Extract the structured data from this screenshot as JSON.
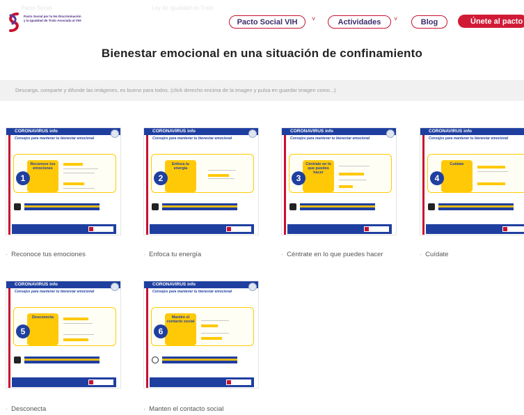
{
  "header": {
    "faded_left": "Pacto Social",
    "faded_mid": "Ley de Igualdad de Trato",
    "logo_text": "Pacto Social por la No Discriminación y la Igualdad de Trato Asociada al VIH",
    "nav": [
      {
        "label": "Pacto Social VIH",
        "has_dropdown": true
      },
      {
        "label": "Actividades",
        "has_dropdown": true
      },
      {
        "label": "Blog",
        "has_dropdown": false
      }
    ],
    "cta_label": "Únete al pacto",
    "accent": "#c8102e",
    "brand": "#3a2d6b"
  },
  "page": {
    "title": "Bienestar emocional en una situación de confinamiento",
    "banner_text": "Descarga, comparte y difunde las imágenes, es bueno para todos. (click derecho encima de la imagen y pulsa en guardar imagen como...)"
  },
  "cards": [
    {
      "number": "1",
      "box_text": "Reconoce tus emociones",
      "caption": "Reconoce tus emociones",
      "header": "CORONAVIRUS info",
      "sub": "Consejos para mantener tu bienestar emocional"
    },
    {
      "number": "2",
      "box_text": "Enfoca tu energía",
      "caption": "Enfoca tu energía",
      "header": "CORONAVIRUS info",
      "sub": "Consejos para mantener tu bienestar emocional"
    },
    {
      "number": "3",
      "box_text": "Céntrate en lo que puedes hacer",
      "caption": "Céntrate en lo que puedes hacer",
      "header": "CORONAVIRUS info",
      "sub": "Consejos para mantener tu bienestar emocional"
    },
    {
      "number": "4",
      "box_text": "Cuídate",
      "caption": "Cuídate",
      "header": "CORONAVIRUS info",
      "sub": "Consejos para mantener tu bienestar emocional"
    },
    {
      "number": "5",
      "box_text": "Desconecta",
      "caption": "Desconecta",
      "header": "CORONAVIRUS info",
      "sub": "Consejos para mantener tu bienestar emocional"
    },
    {
      "number": "6",
      "box_text": "Mantén el contacto social",
      "caption": "Manten el contacto social",
      "header": "CORONAVIRUS info",
      "sub": "Consejos para mantener tu bienestar emocional"
    }
  ],
  "colors": {
    "card_blue": "#1f3fa0",
    "card_yellow": "#ffc907",
    "banner_bg": "#f1f1f1"
  }
}
